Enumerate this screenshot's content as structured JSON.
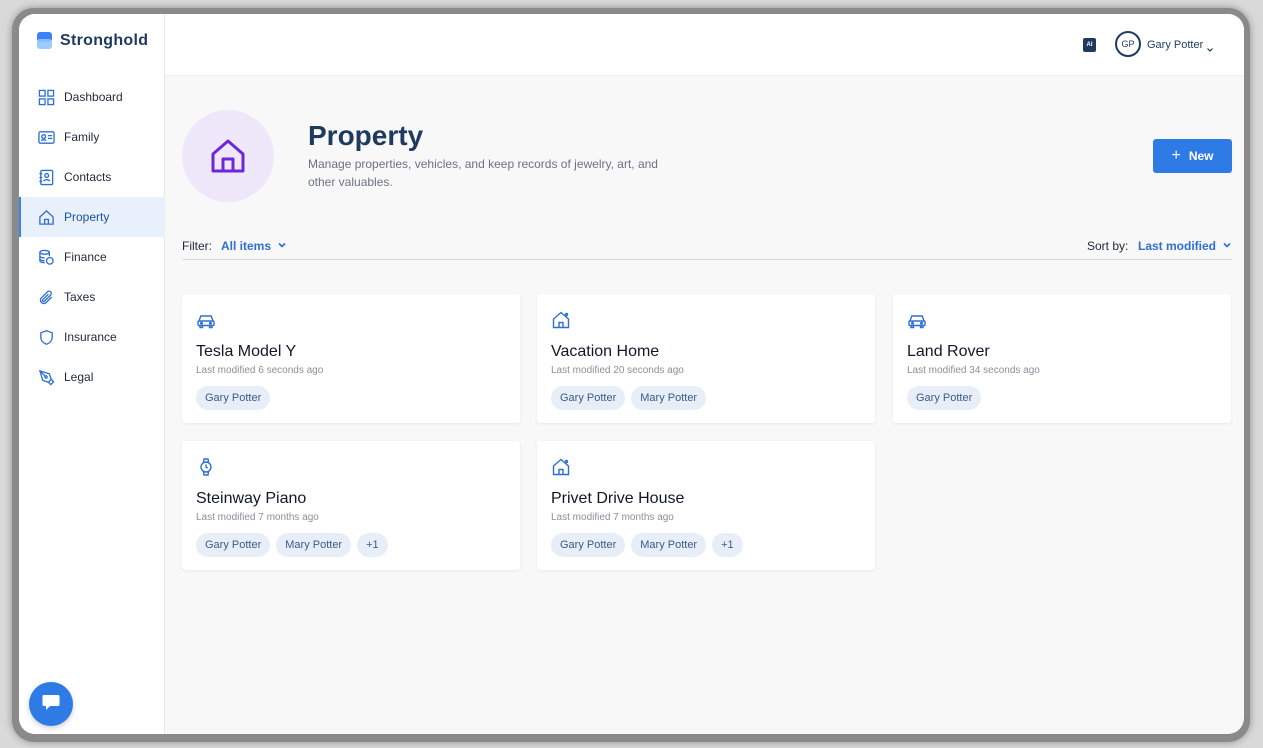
{
  "app": {
    "brand": "Stronghold"
  },
  "sidebar": {
    "items": [
      {
        "label": "Dashboard",
        "icon": "grid-icon",
        "active": false
      },
      {
        "label": "Family",
        "icon": "id-card-icon",
        "active": false
      },
      {
        "label": "Contacts",
        "icon": "contact-book-icon",
        "active": false
      },
      {
        "label": "Property",
        "icon": "house-icon",
        "active": true
      },
      {
        "label": "Finance",
        "icon": "coins-icon",
        "active": false
      },
      {
        "label": "Taxes",
        "icon": "paperclip-icon",
        "active": false
      },
      {
        "label": "Insurance",
        "icon": "shield-icon",
        "active": false
      },
      {
        "label": "Legal",
        "icon": "pen-icon",
        "active": false
      }
    ]
  },
  "topbar": {
    "ai_badge": "AI",
    "avatar_initials": "GP",
    "user_name": "Gary Potter"
  },
  "main": {
    "title": "Property",
    "description": "Manage properties, vehicles, and keep records of jewelry, art, and other valuables.",
    "new_button": "New",
    "filter_label": "Filter:",
    "filter_value": "All items",
    "sort_label": "Sort by:",
    "sort_value": "Last modified"
  },
  "cards": [
    {
      "title": "Tesla Model Y",
      "meta": "Last modified 6 seconds ago",
      "icon": "car-icon",
      "tags": [
        "Gary Potter"
      ]
    },
    {
      "title": "Vacation Home",
      "meta": "Last modified 20 seconds ago",
      "icon": "house-icon",
      "tags": [
        "Gary Potter",
        "Mary Potter"
      ]
    },
    {
      "title": "Land Rover",
      "meta": "Last modified 34 seconds ago",
      "icon": "car-icon",
      "tags": [
        "Gary Potter"
      ]
    },
    {
      "title": "Steinway Piano",
      "meta": "Last modified 7 months ago",
      "icon": "watch-icon",
      "tags": [
        "Gary Potter",
        "Mary Potter",
        "+1"
      ]
    },
    {
      "title": "Privet Drive House",
      "meta": "Last modified 7 months ago",
      "icon": "house-icon",
      "tags": [
        "Gary Potter",
        "Mary Potter",
        "+1"
      ]
    }
  ],
  "colors": {
    "accent": "#2f7be6",
    "brand_text": "#1e3a5f",
    "hero_bg": "#efe8fb",
    "hero_icon": "#6d28d9"
  }
}
